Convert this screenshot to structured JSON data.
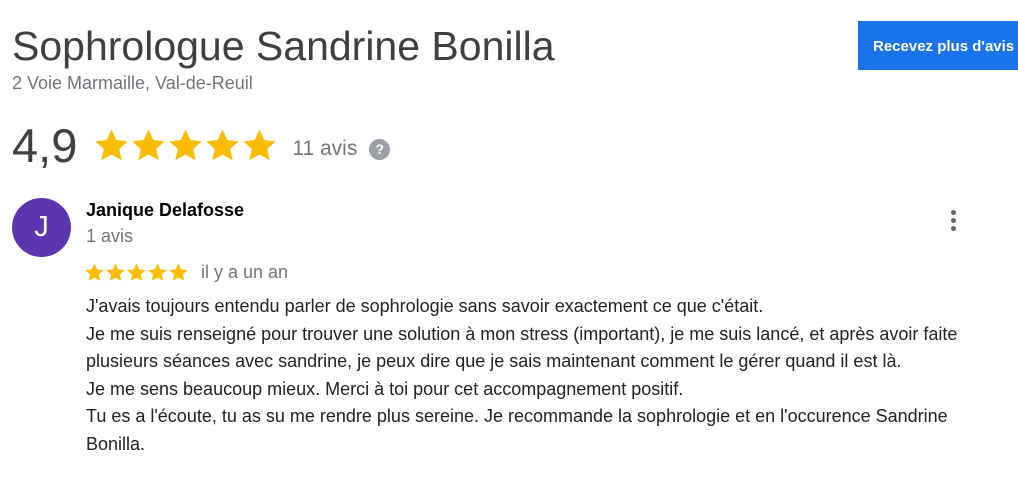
{
  "business": {
    "name": "Sophrologue Sandrine Bonilla",
    "address": "2 Voie Marmaille, Val-de-Reuil",
    "cta_label": "Recevez plus d'avis",
    "rating": "4,9",
    "stars": 5,
    "review_count": "11 avis",
    "help_glyph": "?"
  },
  "review": {
    "avatar_letter": "J",
    "reviewer_name": "Janique Delafosse",
    "reviewer_meta": "1 avis",
    "stars": 5,
    "date": "il y a un an",
    "paragraphs": [
      "J'avais toujours entendu parler de sophrologie sans savoir exactement ce que c'était.",
      "Je me suis renseigné pour trouver une solution à mon stress (important), je me suis lancé, et après avoir faite plusieurs séances avec sandrine, je peux dire que je sais maintenant comment le gérer quand il est là.",
      "Je me sens beaucoup mieux. Merci à toi pour cet accompagnement positif.",
      "Tu es a l'écoute, tu as su me rendre plus sereine. Je recommande la sophrologie et en l'occurence Sandrine Bonilla."
    ]
  },
  "icons": {
    "star": "star-icon",
    "help": "help-circle-icon",
    "more": "more-vert-icon"
  },
  "colors": {
    "star": "#fbbc04",
    "cta_background": "#1a73e8",
    "avatar_background": "#5e35b1",
    "secondary_text": "#70757a"
  }
}
